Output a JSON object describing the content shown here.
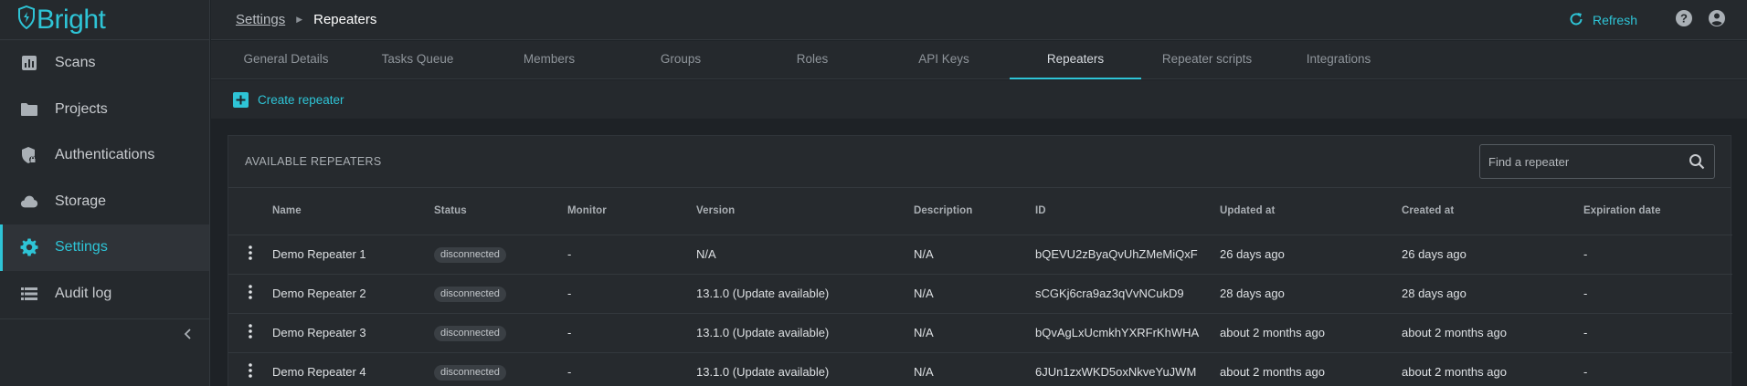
{
  "app": {
    "brand": "Bright"
  },
  "sidebar": {
    "items": [
      {
        "label": "Scans",
        "icon": "bar-chart-icon"
      },
      {
        "label": "Projects",
        "icon": "folder-icon"
      },
      {
        "label": "Authentications",
        "icon": "shield-lock-icon"
      },
      {
        "label": "Storage",
        "icon": "cloud-icon"
      },
      {
        "label": "Settings",
        "icon": "gear-icon",
        "active": true
      },
      {
        "label": "Audit log",
        "icon": "list-icon"
      }
    ]
  },
  "breadcrumb": {
    "parent": "Settings",
    "current": "Repeaters"
  },
  "topbar": {
    "refresh_label": "Refresh"
  },
  "tabs": [
    "General Details",
    "Tasks Queue",
    "Members",
    "Groups",
    "Roles",
    "API Keys",
    "Repeaters",
    "Repeater scripts",
    "Integrations"
  ],
  "active_tab": "Repeaters",
  "actions": {
    "create_label": "Create repeater"
  },
  "card": {
    "title": "AVAILABLE REPEATERS",
    "search_placeholder": "Find a repeater"
  },
  "table": {
    "columns": [
      "Name",
      "Status",
      "Monitor",
      "Version",
      "Description",
      "ID",
      "Updated at",
      "Created at",
      "Expiration date"
    ],
    "rows": [
      {
        "name": "Demo Repeater 1",
        "status": "disconnected",
        "monitor": "-",
        "version": "N/A",
        "description": "N/A",
        "id": "bQEVU2zByaQvUhZMeMiQxF",
        "updated": "26 days ago",
        "created": "26 days ago",
        "expiration": "-"
      },
      {
        "name": "Demo Repeater 2",
        "status": "disconnected",
        "monitor": "-",
        "version": "13.1.0 (Update available)",
        "description": "N/A",
        "id": "sCGKj6cra9az3qVvNCukD9",
        "updated": "28 days ago",
        "created": "28 days ago",
        "expiration": "-"
      },
      {
        "name": "Demo Repeater 3",
        "status": "disconnected",
        "monitor": "-",
        "version": "13.1.0 (Update available)",
        "description": "N/A",
        "id": "bQvAgLxUcmkhYXRFrKhWHA",
        "updated": "about 2 months ago",
        "created": "about 2 months ago",
        "expiration": "-"
      },
      {
        "name": "Demo Repeater 4",
        "status": "disconnected",
        "monitor": "-",
        "version": "13.1.0 (Update available)",
        "description": "N/A",
        "id": "6JUn1zxWKD5oxNkveYuJWM",
        "updated": "about 2 months ago",
        "created": "about 2 months ago",
        "expiration": "-"
      }
    ]
  },
  "colors": {
    "accent": "#2ec4d6",
    "background": "#1e2226",
    "panel": "#25292d"
  }
}
